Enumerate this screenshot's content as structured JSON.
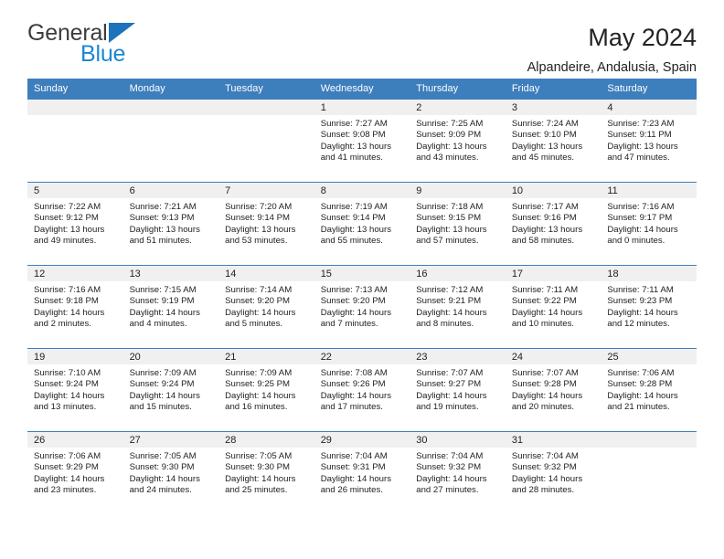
{
  "brand": {
    "name_part1": "General",
    "name_part2": "Blue",
    "logo_icon": "triangle-logo-icon",
    "colors": {
      "accent_blue": "#1c86d4",
      "triangle_blue": "#1c72bb"
    }
  },
  "header": {
    "title": "May 2024",
    "subtitle": "Alpandeire, Andalusia, Spain"
  },
  "theme": {
    "header_row_bg": "#3d7ebd",
    "daynum_bg": "#f0f0f0",
    "grid_line": "#3d7ebd",
    "text": "#222222"
  },
  "calendar": {
    "weekday_headers": [
      "Sunday",
      "Monday",
      "Tuesday",
      "Wednesday",
      "Thursday",
      "Friday",
      "Saturday"
    ],
    "weeks": [
      [
        {
          "day": "",
          "blank": true,
          "sunrise": "",
          "sunset": "",
          "daylight": ""
        },
        {
          "day": "",
          "blank": true,
          "sunrise": "",
          "sunset": "",
          "daylight": ""
        },
        {
          "day": "",
          "blank": true,
          "sunrise": "",
          "sunset": "",
          "daylight": ""
        },
        {
          "day": "1",
          "blank": false,
          "sunrise": "Sunrise: 7:27 AM",
          "sunset": "Sunset: 9:08 PM",
          "daylight": "Daylight: 13 hours and 41 minutes."
        },
        {
          "day": "2",
          "blank": false,
          "sunrise": "Sunrise: 7:25 AM",
          "sunset": "Sunset: 9:09 PM",
          "daylight": "Daylight: 13 hours and 43 minutes."
        },
        {
          "day": "3",
          "blank": false,
          "sunrise": "Sunrise: 7:24 AM",
          "sunset": "Sunset: 9:10 PM",
          "daylight": "Daylight: 13 hours and 45 minutes."
        },
        {
          "day": "4",
          "blank": false,
          "sunrise": "Sunrise: 7:23 AM",
          "sunset": "Sunset: 9:11 PM",
          "daylight": "Daylight: 13 hours and 47 minutes."
        }
      ],
      [
        {
          "day": "5",
          "blank": false,
          "sunrise": "Sunrise: 7:22 AM",
          "sunset": "Sunset: 9:12 PM",
          "daylight": "Daylight: 13 hours and 49 minutes."
        },
        {
          "day": "6",
          "blank": false,
          "sunrise": "Sunrise: 7:21 AM",
          "sunset": "Sunset: 9:13 PM",
          "daylight": "Daylight: 13 hours and 51 minutes."
        },
        {
          "day": "7",
          "blank": false,
          "sunrise": "Sunrise: 7:20 AM",
          "sunset": "Sunset: 9:14 PM",
          "daylight": "Daylight: 13 hours and 53 minutes."
        },
        {
          "day": "8",
          "blank": false,
          "sunrise": "Sunrise: 7:19 AM",
          "sunset": "Sunset: 9:14 PM",
          "daylight": "Daylight: 13 hours and 55 minutes."
        },
        {
          "day": "9",
          "blank": false,
          "sunrise": "Sunrise: 7:18 AM",
          "sunset": "Sunset: 9:15 PM",
          "daylight": "Daylight: 13 hours and 57 minutes."
        },
        {
          "day": "10",
          "blank": false,
          "sunrise": "Sunrise: 7:17 AM",
          "sunset": "Sunset: 9:16 PM",
          "daylight": "Daylight: 13 hours and 58 minutes."
        },
        {
          "day": "11",
          "blank": false,
          "sunrise": "Sunrise: 7:16 AM",
          "sunset": "Sunset: 9:17 PM",
          "daylight": "Daylight: 14 hours and 0 minutes."
        }
      ],
      [
        {
          "day": "12",
          "blank": false,
          "sunrise": "Sunrise: 7:16 AM",
          "sunset": "Sunset: 9:18 PM",
          "daylight": "Daylight: 14 hours and 2 minutes."
        },
        {
          "day": "13",
          "blank": false,
          "sunrise": "Sunrise: 7:15 AM",
          "sunset": "Sunset: 9:19 PM",
          "daylight": "Daylight: 14 hours and 4 minutes."
        },
        {
          "day": "14",
          "blank": false,
          "sunrise": "Sunrise: 7:14 AM",
          "sunset": "Sunset: 9:20 PM",
          "daylight": "Daylight: 14 hours and 5 minutes."
        },
        {
          "day": "15",
          "blank": false,
          "sunrise": "Sunrise: 7:13 AM",
          "sunset": "Sunset: 9:20 PM",
          "daylight": "Daylight: 14 hours and 7 minutes."
        },
        {
          "day": "16",
          "blank": false,
          "sunrise": "Sunrise: 7:12 AM",
          "sunset": "Sunset: 9:21 PM",
          "daylight": "Daylight: 14 hours and 8 minutes."
        },
        {
          "day": "17",
          "blank": false,
          "sunrise": "Sunrise: 7:11 AM",
          "sunset": "Sunset: 9:22 PM",
          "daylight": "Daylight: 14 hours and 10 minutes."
        },
        {
          "day": "18",
          "blank": false,
          "sunrise": "Sunrise: 7:11 AM",
          "sunset": "Sunset: 9:23 PM",
          "daylight": "Daylight: 14 hours and 12 minutes."
        }
      ],
      [
        {
          "day": "19",
          "blank": false,
          "sunrise": "Sunrise: 7:10 AM",
          "sunset": "Sunset: 9:24 PM",
          "daylight": "Daylight: 14 hours and 13 minutes."
        },
        {
          "day": "20",
          "blank": false,
          "sunrise": "Sunrise: 7:09 AM",
          "sunset": "Sunset: 9:24 PM",
          "daylight": "Daylight: 14 hours and 15 minutes."
        },
        {
          "day": "21",
          "blank": false,
          "sunrise": "Sunrise: 7:09 AM",
          "sunset": "Sunset: 9:25 PM",
          "daylight": "Daylight: 14 hours and 16 minutes."
        },
        {
          "day": "22",
          "blank": false,
          "sunrise": "Sunrise: 7:08 AM",
          "sunset": "Sunset: 9:26 PM",
          "daylight": "Daylight: 14 hours and 17 minutes."
        },
        {
          "day": "23",
          "blank": false,
          "sunrise": "Sunrise: 7:07 AM",
          "sunset": "Sunset: 9:27 PM",
          "daylight": "Daylight: 14 hours and 19 minutes."
        },
        {
          "day": "24",
          "blank": false,
          "sunrise": "Sunrise: 7:07 AM",
          "sunset": "Sunset: 9:28 PM",
          "daylight": "Daylight: 14 hours and 20 minutes."
        },
        {
          "day": "25",
          "blank": false,
          "sunrise": "Sunrise: 7:06 AM",
          "sunset": "Sunset: 9:28 PM",
          "daylight": "Daylight: 14 hours and 21 minutes."
        }
      ],
      [
        {
          "day": "26",
          "blank": false,
          "sunrise": "Sunrise: 7:06 AM",
          "sunset": "Sunset: 9:29 PM",
          "daylight": "Daylight: 14 hours and 23 minutes."
        },
        {
          "day": "27",
          "blank": false,
          "sunrise": "Sunrise: 7:05 AM",
          "sunset": "Sunset: 9:30 PM",
          "daylight": "Daylight: 14 hours and 24 minutes."
        },
        {
          "day": "28",
          "blank": false,
          "sunrise": "Sunrise: 7:05 AM",
          "sunset": "Sunset: 9:30 PM",
          "daylight": "Daylight: 14 hours and 25 minutes."
        },
        {
          "day": "29",
          "blank": false,
          "sunrise": "Sunrise: 7:04 AM",
          "sunset": "Sunset: 9:31 PM",
          "daylight": "Daylight: 14 hours and 26 minutes."
        },
        {
          "day": "30",
          "blank": false,
          "sunrise": "Sunrise: 7:04 AM",
          "sunset": "Sunset: 9:32 PM",
          "daylight": "Daylight: 14 hours and 27 minutes."
        },
        {
          "day": "31",
          "blank": false,
          "sunrise": "Sunrise: 7:04 AM",
          "sunset": "Sunset: 9:32 PM",
          "daylight": "Daylight: 14 hours and 28 minutes."
        },
        {
          "day": "",
          "blank": true,
          "sunrise": "",
          "sunset": "",
          "daylight": ""
        }
      ]
    ]
  }
}
